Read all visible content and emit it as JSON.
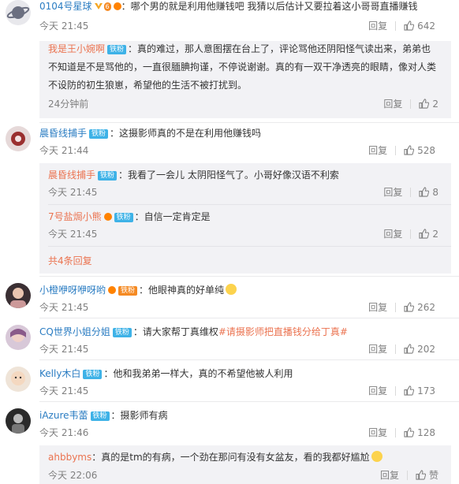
{
  "comments": [
    {
      "user": "0104号星球",
      "text": "：哪个男的就是利用他赚钱吧 我猜以后估计又要拉着这小哥哥直播赚钱",
      "time": "今天 21:45",
      "reply": "回复",
      "likes": "642"
    },
    {
      "user": "晨昏线捕手",
      "badge": "铁粉",
      "text": "：这摄影师真的不是在利用他赚钱吗",
      "time": "今天 21:44",
      "reply": "回复",
      "likes": "528"
    },
    {
      "user": "小橙咿呀咿呀哟",
      "text": "：他眼神真的好单纯",
      "time": "今天 21:45",
      "reply": "回复",
      "likes": "262"
    },
    {
      "user": "CQ世界小姐分姐",
      "badge": "铁粉",
      "text_a": "：请大家帮丁真维权",
      "text_link": "#请摄影师把直播钱分给丁真#",
      "time": "今天 21:45",
      "reply": "回复",
      "likes": "202"
    },
    {
      "user": "Kelly木白",
      "badge": "铁粉",
      "text": "：他和我弟弟一样大，真的不希望他被人利用",
      "time": "今天 21:45",
      "reply": "回复",
      "likes": "173"
    },
    {
      "user": "iAzure韦蕾",
      "badge": "铁粉",
      "text": "：摄影师有病",
      "time": "今天 21:46",
      "reply": "回复",
      "likes": "128"
    }
  ],
  "replies": [
    {
      "user": "我是王小婉啊",
      "badge": "铁粉",
      "line1": "：真的难过，那人意图摆在台上了，评论骂他还阴阳怪气读出来，弟弟也",
      "line2": "不知道是不是骂他的，一直很腼腆拘谨，不停说谢谢。真的有一双干净透亮的眼睛，像对人类",
      "line3": "不设防的初生狼崽，希望他的生活不被打扰到。",
      "time": "24分钟前",
      "reply": "回复",
      "likes": "2"
    },
    {
      "user": "晨昏线捕手",
      "badge": "铁粉",
      "text": "：我看了一会儿 太阴阳怪气了。小哥好像汉语不利索",
      "time": "今天 21:45",
      "reply": "回复",
      "likes": "8"
    },
    {
      "user": "7号盐焗小熊",
      "badge": "铁粉",
      "text": "：自信一定肯定是",
      "time": "今天 21:45",
      "reply": "回复",
      "likes": "2"
    },
    {
      "user": "ahbbyms",
      "text": "：真的是tm的有病，一个劲在那问有没有女盆友，看的我都好尴尬",
      "time": "今天 22:06",
      "reply": "回复",
      "likes": "赞"
    }
  ],
  "more_replies": "共4条回复",
  "level_badge": "6"
}
